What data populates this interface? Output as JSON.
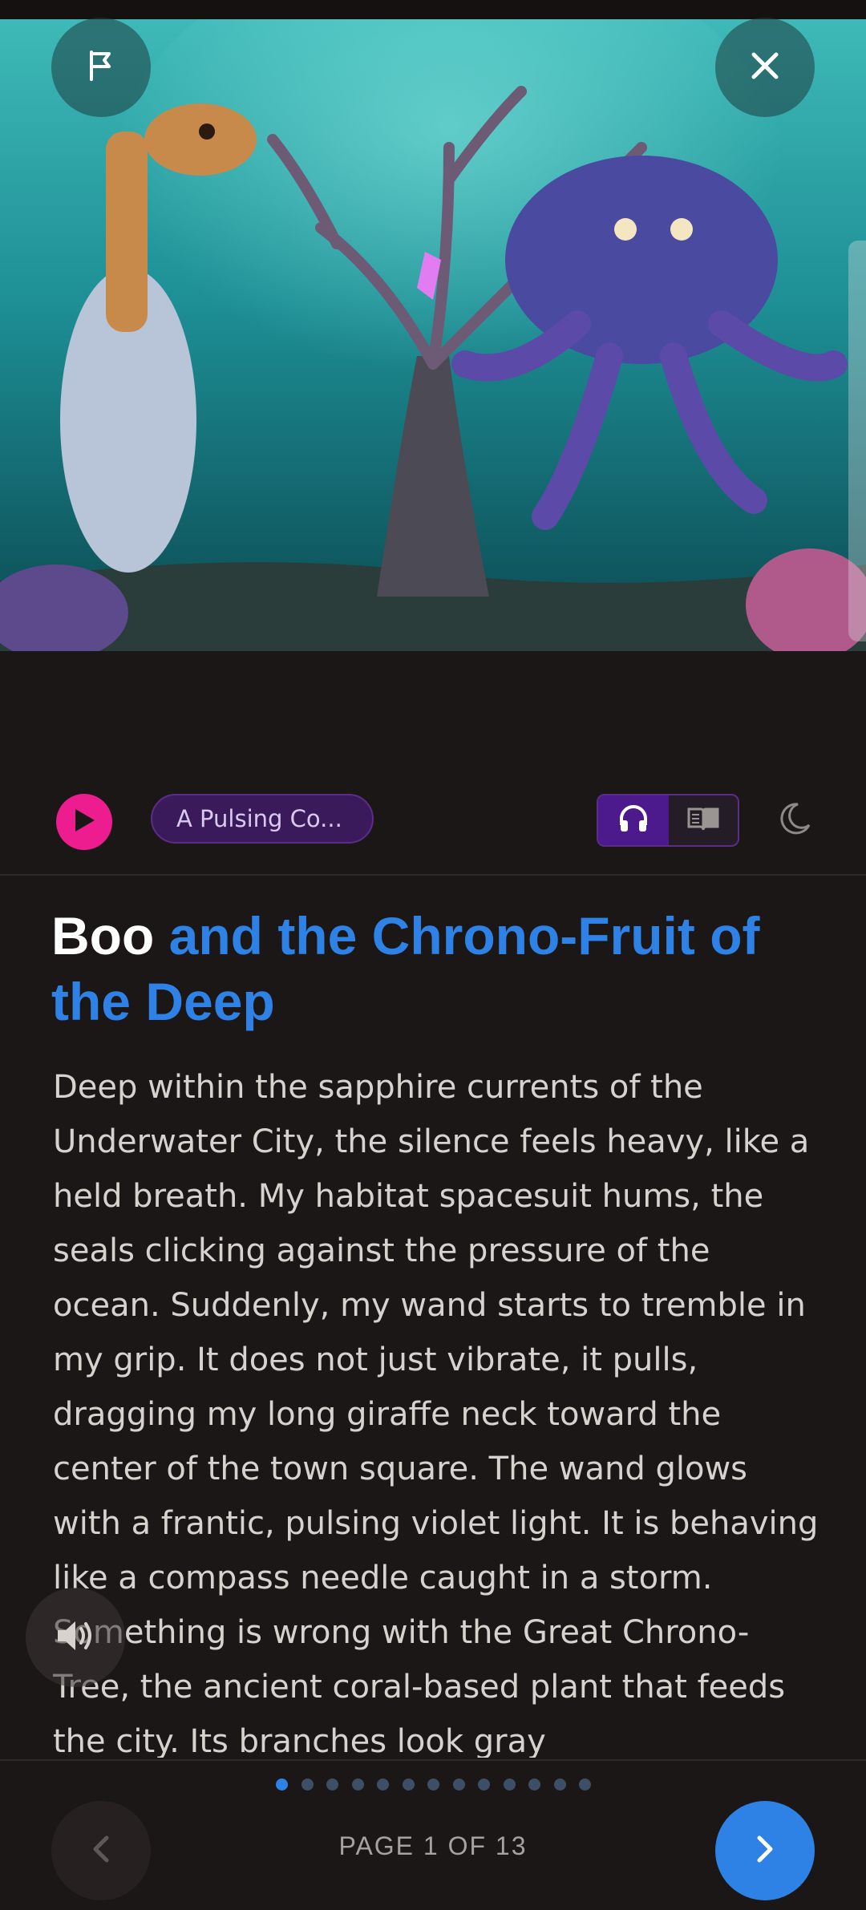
{
  "toolbar": {
    "chapter_chip": "A Pulsing Co...",
    "listen_mode_icon": "headphones-icon",
    "read_mode_icon": "book-icon",
    "theme_icon": "moon-icon"
  },
  "story": {
    "title_highlight": "Boo",
    "title_rest": "and the Chrono-Fruit of the Deep",
    "text": "Deep within the sapphire currents of the Underwater City, the silence feels heavy, like a held breath. My habitat spacesuit hums, the seals clicking against the pressure of the ocean. Suddenly, my wand starts to tremble in my grip. It does not just vibrate, it pulls, dragging my long giraffe neck toward the center of the town square. The wand glows with a frantic, pulsing violet light. It is behaving like a compass needle caught in a storm. Something is wrong with the Great Chrono-Tree, the ancient coral-based plant that feeds the city. Its branches look gray"
  },
  "pager": {
    "label": "PAGE 1 OF 13",
    "current_page": 1,
    "total_pages": 13
  },
  "colors": {
    "accent": "#2e82e6",
    "play": "#ee1d8f",
    "chip_bg": "#3b1a5c",
    "background": "#1b1716"
  },
  "icons": {
    "flag": "flag-icon",
    "close": "close-icon",
    "play": "play-icon",
    "sound": "speaker-icon",
    "prev": "chevron-left-icon",
    "next": "chevron-right-icon"
  }
}
